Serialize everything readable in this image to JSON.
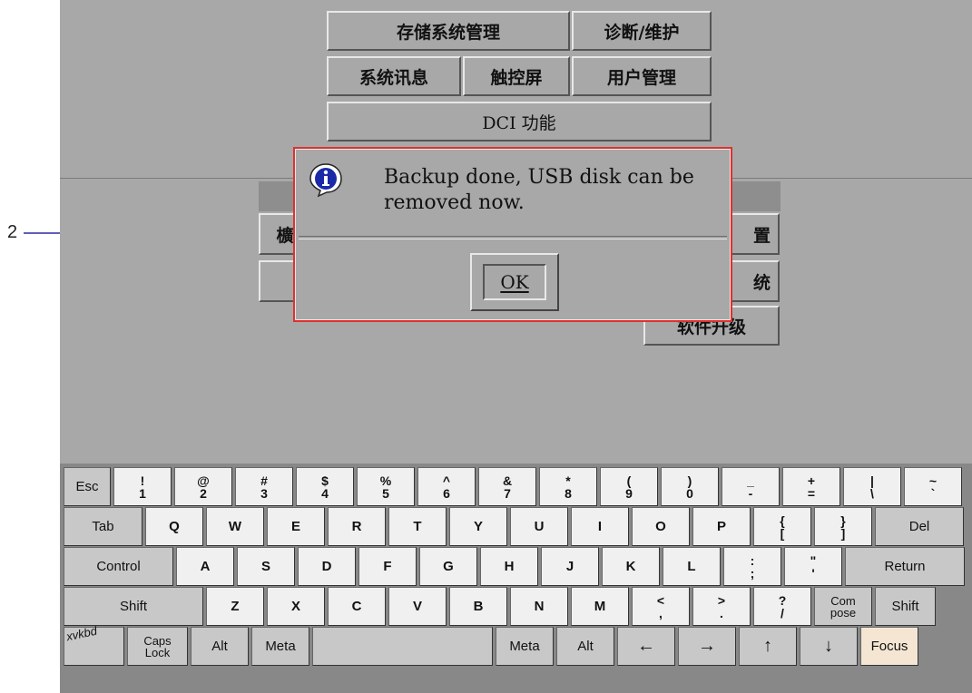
{
  "annotation": {
    "number": "2"
  },
  "menu": {
    "storage_mgmt": "存储系统管理",
    "diagnostics": "诊断/维护",
    "system_info": "系统讯息",
    "touchscreen": "触控屏",
    "user_mgmt": "用户管理",
    "dci": "DCI 功能",
    "lower_left_partial": "櫎",
    "settings_partial": "置",
    "system_partial": "统",
    "software_upgrade": "软件升级"
  },
  "dialog": {
    "message": "Backup done, USB disk can be removed now.",
    "ok_label": "OK",
    "icon": "info-icon",
    "border_color": "#e03030"
  },
  "keyboard": {
    "row1": [
      {
        "id": "esc",
        "label": "Esc"
      },
      {
        "id": "1",
        "top": "!",
        "bottom": "1"
      },
      {
        "id": "2",
        "top": "@",
        "bottom": "2"
      },
      {
        "id": "3",
        "top": "#",
        "bottom": "3"
      },
      {
        "id": "4",
        "top": "$",
        "bottom": "4"
      },
      {
        "id": "5",
        "top": "%",
        "bottom": "5"
      },
      {
        "id": "6",
        "top": "^",
        "bottom": "6"
      },
      {
        "id": "7",
        "top": "&",
        "bottom": "7"
      },
      {
        "id": "8",
        "top": "*",
        "bottom": "8"
      },
      {
        "id": "9",
        "top": "(",
        "bottom": "9"
      },
      {
        "id": "0",
        "top": ")",
        "bottom": "0"
      },
      {
        "id": "minus",
        "top": "_",
        "bottom": "-"
      },
      {
        "id": "equal",
        "top": "+",
        "bottom": "="
      },
      {
        "id": "backslash",
        "top": "|",
        "bottom": "\\"
      },
      {
        "id": "tilde",
        "top": "~",
        "bottom": "`"
      }
    ],
    "row2": [
      {
        "id": "tab",
        "label": "Tab"
      },
      {
        "id": "q",
        "label": "Q"
      },
      {
        "id": "w",
        "label": "W"
      },
      {
        "id": "e",
        "label": "E"
      },
      {
        "id": "r",
        "label": "R"
      },
      {
        "id": "t",
        "label": "T"
      },
      {
        "id": "y",
        "label": "Y"
      },
      {
        "id": "u",
        "label": "U"
      },
      {
        "id": "i",
        "label": "I"
      },
      {
        "id": "o",
        "label": "O"
      },
      {
        "id": "p",
        "label": "P"
      },
      {
        "id": "lbrace",
        "top": "{",
        "bottom": "["
      },
      {
        "id": "rbrace",
        "top": "}",
        "bottom": "]"
      },
      {
        "id": "del",
        "label": "Del"
      }
    ],
    "row3": [
      {
        "id": "control",
        "label": "Control"
      },
      {
        "id": "a",
        "label": "A"
      },
      {
        "id": "s",
        "label": "S"
      },
      {
        "id": "d",
        "label": "D"
      },
      {
        "id": "f",
        "label": "F"
      },
      {
        "id": "g",
        "label": "G"
      },
      {
        "id": "h",
        "label": "H"
      },
      {
        "id": "j",
        "label": "J"
      },
      {
        "id": "k",
        "label": "K"
      },
      {
        "id": "l",
        "label": "L"
      },
      {
        "id": "semicolon",
        "top": ":",
        "bottom": ";"
      },
      {
        "id": "quote",
        "top": "\"",
        "bottom": "'"
      },
      {
        "id": "return",
        "label": "Return"
      }
    ],
    "row4": [
      {
        "id": "shift-left",
        "label": "Shift"
      },
      {
        "id": "z",
        "label": "Z"
      },
      {
        "id": "x",
        "label": "X"
      },
      {
        "id": "c",
        "label": "C"
      },
      {
        "id": "v",
        "label": "V"
      },
      {
        "id": "b",
        "label": "B"
      },
      {
        "id": "n",
        "label": "N"
      },
      {
        "id": "m",
        "label": "M"
      },
      {
        "id": "comma",
        "top": "<",
        "bottom": ","
      },
      {
        "id": "period",
        "top": ">",
        "bottom": "."
      },
      {
        "id": "slash",
        "top": "?",
        "bottom": "/"
      },
      {
        "id": "compose",
        "label": "Com pose"
      },
      {
        "id": "shift-right",
        "label": "Shift"
      }
    ],
    "row5": [
      {
        "id": "xvkbd",
        "label": "xvkbd"
      },
      {
        "id": "capslock",
        "label": "Caps Lock"
      },
      {
        "id": "alt-left",
        "label": "Alt"
      },
      {
        "id": "meta-left",
        "label": "Meta"
      },
      {
        "id": "space",
        "label": ""
      },
      {
        "id": "meta-right",
        "label": "Meta"
      },
      {
        "id": "alt-right",
        "label": "Alt"
      },
      {
        "id": "left",
        "label": "←"
      },
      {
        "id": "right",
        "label": "→"
      },
      {
        "id": "up",
        "label": "↑"
      },
      {
        "id": "down",
        "label": "↓"
      },
      {
        "id": "focus",
        "label": "Focus"
      }
    ]
  }
}
